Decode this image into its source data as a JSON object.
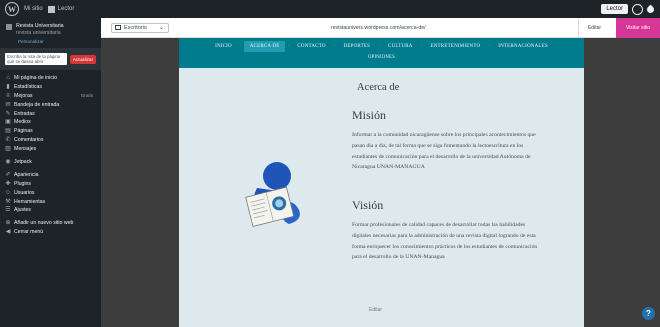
{
  "adminbar": {
    "site": "Mi sitio",
    "account": "Lector",
    "edit": "Lector"
  },
  "sidebar": {
    "site_title": "Revista Universitaria",
    "site_subtitle": "revista universitaria",
    "publish_tag": "Personalizar",
    "search_placeholder": "Escriba la ruta de la página que se desea abrir",
    "search_button": "Actualizar",
    "menu": [
      {
        "icon": "home-icon",
        "label": "Mi página de inicio",
        "count": ""
      },
      {
        "icon": "stats-icon",
        "label": "Estadísticas",
        "count": ""
      },
      {
        "icon": "pages-icon",
        "label": "Mejoras",
        "count": "Gratis"
      },
      {
        "icon": "inbox-icon",
        "label": "Bandeja de entrada",
        "count": ""
      },
      {
        "icon": "posts-icon",
        "label": "Entradas",
        "count": ""
      },
      {
        "icon": "media-icon",
        "label": "Medios",
        "count": ""
      },
      {
        "icon": "page-icon",
        "label": "Páginas",
        "count": ""
      },
      {
        "icon": "comments-icon",
        "label": "Comentarios",
        "count": ""
      },
      {
        "icon": "feedback-icon",
        "label": "Mensajes",
        "count": ""
      },
      {
        "icon": "jetpack-icon",
        "label": "Jetpack",
        "count": ""
      },
      {
        "icon": "appearance-icon",
        "label": "Apariencia",
        "count": ""
      },
      {
        "icon": "plugins-icon",
        "label": "Plugins",
        "count": ""
      },
      {
        "icon": "users-icon",
        "label": "Usuarios",
        "count": ""
      },
      {
        "icon": "tools-icon",
        "label": "Herramientas",
        "count": ""
      },
      {
        "icon": "settings-icon",
        "label": "Ajustes",
        "count": ""
      },
      {
        "icon": "add-icon",
        "label": "Añadir un nuevo sitio web",
        "count": ""
      },
      {
        "icon": "collapse-icon",
        "label": "Cerrar menú",
        "count": ""
      }
    ]
  },
  "toolbar": {
    "device": "Escritorio",
    "url": "revistaunivers.wordpress.com/acerca-de/",
    "edit_label": "Editar",
    "visit_label": "Visitar sitio"
  },
  "nav": {
    "items": [
      "INICIO",
      "ACERCA DE",
      "CONTACTO",
      "DEPORTES",
      "CULTURA",
      "ENTRETENIMIENTO",
      "INTERNACIONALES"
    ],
    "active_index": 1,
    "second_row": "OPINIONES"
  },
  "content": {
    "page_title": "Acerca de",
    "mision_heading": "Misión",
    "mision_text": "Informar a la comunidad nicaragüense sobre los principales acontecimientos que pasan día a día, de tal forma que se siga fomentando la lectoescritura en los estudiantes de comunicación para el desarrollo de la universidad Autónoma de Nicaragua UNAN-MANAGUA",
    "vision_heading": "Visión",
    "vision_text": "Formar profesionales de calidad capaces de desarrollar todas las habilidades digitales necesarias para la administración de una revista digital logrando de esta forma enriquecer los conocimientos prácticos de los estudiantes de comunicación para el desarrollo de la UNAN-Managua",
    "footer_edit": "Editar"
  },
  "colors": {
    "nav_bg": "#007c8d",
    "nav_active": "#1e9db3",
    "page_bg": "#dde9ec",
    "visit_btn": "#d63695",
    "admin_bg": "#1d2327"
  },
  "help": "?"
}
